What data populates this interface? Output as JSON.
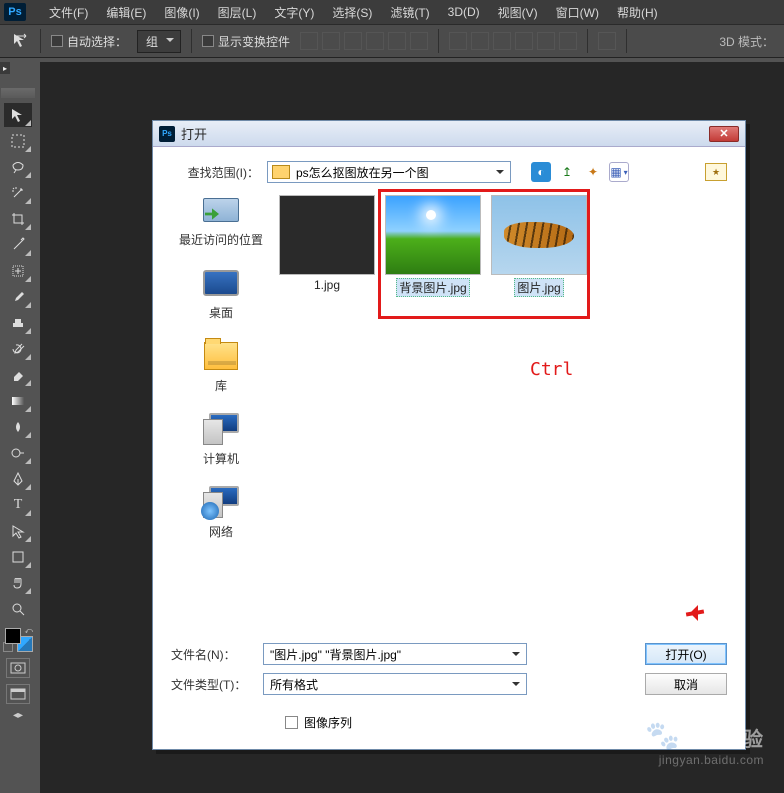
{
  "menubar": {
    "items": [
      "文件(F)",
      "编辑(E)",
      "图像(I)",
      "图层(L)",
      "文字(Y)",
      "选择(S)",
      "滤镜(T)",
      "3D(D)",
      "视图(V)",
      "窗口(W)",
      "帮助(H)"
    ]
  },
  "optionsbar": {
    "auto_select_label": "自动选择：",
    "group_label": "组",
    "show_transform_label": "显示变换控件",
    "mode3d_label": "3D 模式："
  },
  "dialog": {
    "title": "打开",
    "lookin_label": "查找范围(I)：",
    "lookin_value": "ps怎么抠图放在另一个图",
    "nav": {
      "recent": "最近访问的位置",
      "desktop": "桌面",
      "library": "库",
      "computer": "计算机",
      "network": "网络"
    },
    "files": [
      {
        "name": "1.jpg",
        "selected": false,
        "kind": "ps"
      },
      {
        "name": "背景图片.jpg",
        "selected": true,
        "kind": "bg"
      },
      {
        "name": "图片.jpg",
        "selected": true,
        "kind": "tiger"
      }
    ],
    "annotation": "Ctrl",
    "filename_label": "文件名(N)：",
    "filename_value": "\"图片.jpg\" \"背景图片.jpg\"",
    "filetype_label": "文件类型(T)：",
    "filetype_value": "所有格式",
    "open_btn": "打开(O)",
    "cancel_btn": "取消",
    "sequence_label": "图像序列"
  },
  "watermark": {
    "brand_en": "Baidu",
    "brand_cn": "经验",
    "url": "jingyan.baidu.com"
  }
}
